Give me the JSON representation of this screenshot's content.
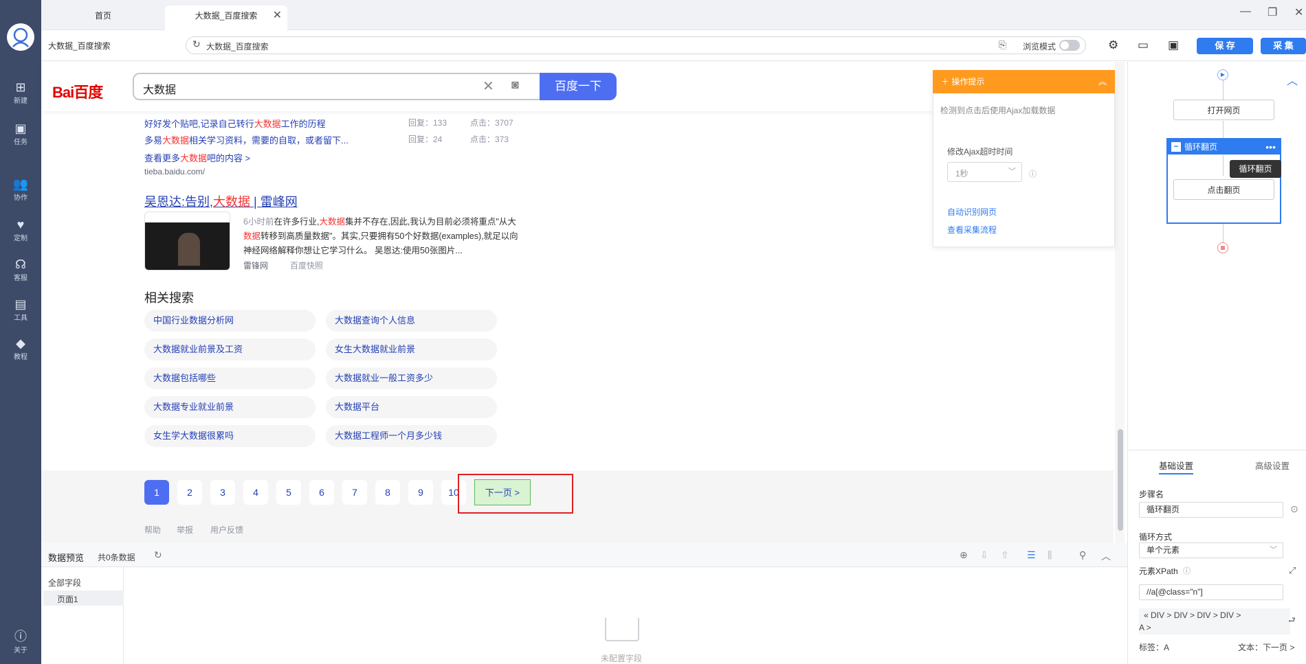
{
  "tabs": {
    "home": "首页",
    "active": "大数据_百度搜索"
  },
  "toolbar": {
    "page_label": "大数据_百度搜索",
    "address": "大数据_百度搜索",
    "browse_mode": "浏览模式",
    "save": "保 存",
    "collect": "采 集"
  },
  "sidebar": {
    "items": [
      {
        "label": "新建",
        "icon": "plus-icon"
      },
      {
        "label": "任务",
        "icon": "bookmark-icon"
      },
      {
        "label": "协作",
        "icon": "people-icon"
      },
      {
        "label": "定制",
        "icon": "heart-icon"
      },
      {
        "label": "客服",
        "icon": "headset-icon"
      },
      {
        "label": "工具",
        "icon": "toolbox-icon"
      },
      {
        "label": "教程",
        "icon": "graduation-icon"
      }
    ],
    "about": "关于"
  },
  "baidu": {
    "logo": "Bai百度",
    "query": "大数据",
    "search_button": "百度一下"
  },
  "results": {
    "tieba_line1_a": "好好发个贴吧,记录自己转行",
    "tieba_line1_hl": "大数据",
    "tieba_line1_b": "工作的历程",
    "tieba_line1_reply": "回复：133",
    "tieba_line1_click": "点击：3707",
    "tieba_line2_a": "多易",
    "tieba_line2_hl": "大数据",
    "tieba_line2_b": "相关学习资料，需要的自取，或者留下...",
    "tieba_line2_reply": "回复：24",
    "tieba_line2_click": "点击：373",
    "tieba_more_a": "查看更多",
    "tieba_more_hl": "大数据",
    "tieba_more_b": "吧的内容 >",
    "tieba_url": "tieba.baidu.com/",
    "title_a": "吴恩达:告别,",
    "title_hl": "大数据",
    "title_b": " | 雷峰网",
    "desc1_a": "6小时前",
    "desc1_b": "在许多行业,",
    "desc1_hl": "大数据",
    "desc1_c": "集并不存在,因此,我认为目前必须将重点\"从大",
    "desc2_hl": "数据",
    "desc2_b": "转移到高质量数据\"。其实,只要拥有50个好数据(examples),就足以向",
    "desc3": "神经网络解释你想让它学习什么。 吴恩达:使用50张图片...",
    "source": "雷锋网",
    "snapshot": "百度快照"
  },
  "related": {
    "title": "相关搜索",
    "items": [
      "中国行业数据分析网",
      "大数据查询个人信息",
      "大数据就业前景及工资",
      "女生大数据就业前景",
      "大数据包括哪些",
      "大数据就业一般工资多少",
      "大数据专业就业前景",
      "大数据平台",
      "女生学大数据很累吗",
      "大数据工程师一个月多少钱"
    ]
  },
  "pager": {
    "pages": [
      "1",
      "2",
      "3",
      "4",
      "5",
      "6",
      "7",
      "8",
      "9",
      "10"
    ],
    "current": "1",
    "next": "下一页 >",
    "footer": [
      "帮助",
      "举报",
      "用户反馈"
    ]
  },
  "op_tip": {
    "title": "操作提示",
    "detected": "检测到点击后使用Ajax加载数据",
    "timeout_label": "修改Ajax超时时间",
    "timeout_value": "1秒",
    "link1": "自动识别网页",
    "link2": "查看采集流程"
  },
  "flow": {
    "open_page": "打开网页",
    "loop": "循环翻页",
    "loop_tooltip": "循环翻页",
    "click_next": "点击翻页"
  },
  "settings": {
    "tab_basic": "基础设置",
    "tab_advanced": "高级设置",
    "step_name_label": "步骤名",
    "step_name": "循环翻页",
    "loop_mode_label": "循环方式",
    "loop_mode": "单个元素",
    "xpath_label": "元素XPath",
    "xpath": "//a[@class=\"n\"]",
    "path": "« DIV > DIV > DIV > DIV >",
    "path2": "A >",
    "tag_label": "标签：A",
    "text_label": "文本：下一页 >"
  },
  "preview": {
    "title": "数据预览",
    "count": "共0条数据",
    "all_fields": "全部字段",
    "page1": "页面1",
    "empty": "未配置字段"
  },
  "colors": {
    "sidebar": "#3d4b69",
    "accent": "#2f7bf0",
    "baidu_blue": "#4e6ef2",
    "highlight_red": "#f73131",
    "tip_orange": "#ff9a1f"
  }
}
